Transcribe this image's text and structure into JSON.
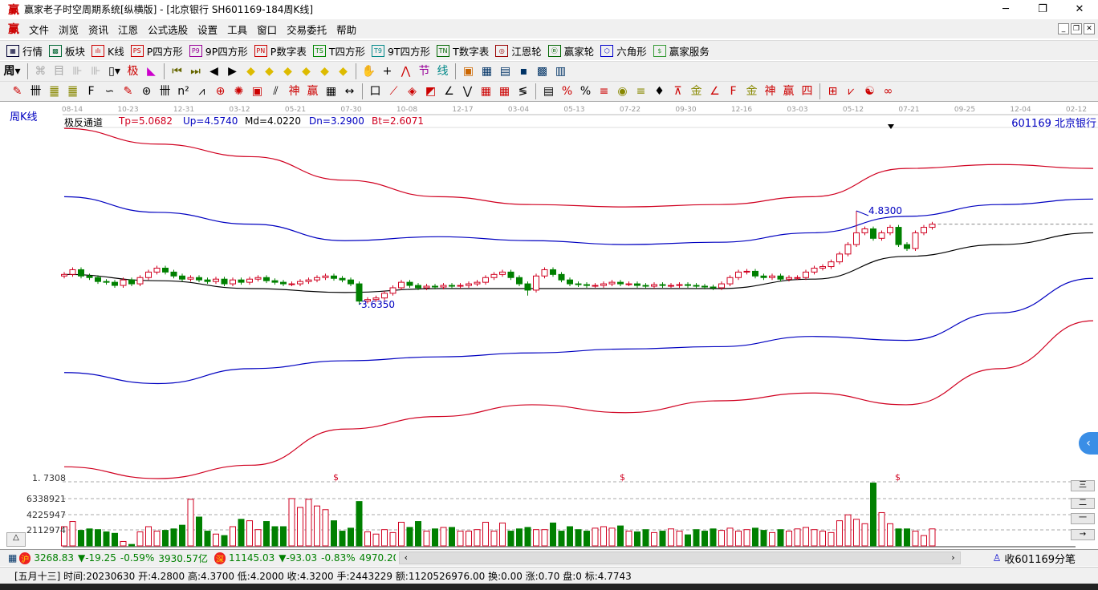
{
  "window": {
    "title": "赢家老子时空周期系统[纵横版] - [北京银行  SH601169-184周K线]",
    "logo": "赢"
  },
  "menu": [
    "文件",
    "浏览",
    "资讯",
    "江恩",
    "公式选股",
    "设置",
    "工具",
    "窗口",
    "交易委托",
    "帮助"
  ],
  "toolbar1": [
    {
      "icon": "grid",
      "glyph": "▦",
      "label": "行情",
      "color": "#003"
    },
    {
      "icon": "blocks",
      "glyph": "▩",
      "label": "板块",
      "color": "#063"
    },
    {
      "icon": "kline",
      "glyph": "ılı",
      "label": "K线",
      "color": "#c00"
    },
    {
      "icon": "PS",
      "glyph": "PS",
      "label": "P四方形",
      "color": "#c00"
    },
    {
      "icon": "P9",
      "glyph": "P9",
      "label": "9P四方形",
      "color": "#909"
    },
    {
      "icon": "PN",
      "glyph": "PN",
      "label": "P数字表",
      "color": "#c00"
    },
    {
      "icon": "TS",
      "glyph": "TS",
      "label": "T四方形",
      "color": "#080"
    },
    {
      "icon": "T9",
      "glyph": "T9",
      "label": "9T四方形",
      "color": "#088"
    },
    {
      "icon": "TN",
      "glyph": "TN",
      "label": "T数字表",
      "color": "#060"
    },
    {
      "icon": "gann-wheel",
      "glyph": "◎",
      "label": "江恩轮",
      "color": "#900"
    },
    {
      "icon": "big-wheel",
      "glyph": "Ⓑ",
      "label": "赢家轮",
      "color": "#060"
    },
    {
      "icon": "hexagon",
      "glyph": "⬡",
      "label": "六角形",
      "color": "#00c"
    },
    {
      "icon": "dollar",
      "glyph": "$",
      "label": "赢家服务",
      "color": "#393"
    }
  ],
  "period_selector": "周",
  "stock_label": "周K线",
  "indicator": {
    "name": "极反通道",
    "tp": "Tp=5.0682",
    "up": "Up=4.5740",
    "md": "Md=4.0220",
    "dn": "Dn=3.2900",
    "bt": "Bt=2.6071"
  },
  "stock_code_name": "601169  北京银行",
  "date_axis": [
    "08-14",
    "10-23",
    "12-31",
    "03-12",
    "05-21",
    "07-30",
    "10-08",
    "12-17",
    "03-04",
    "05-13",
    "07-22",
    "09-30",
    "12-16",
    "03-03",
    "05-12",
    "07-21",
    "09-25",
    "12-04",
    "02-12"
  ],
  "annotations": {
    "high": "4.8300",
    "low": "3.6350",
    "axis_low": "1. 7308",
    "dollar": "$"
  },
  "volume_axis": [
    "6338921",
    "4225947",
    "2112974"
  ],
  "status": {
    "sh": {
      "badge": "沪",
      "value": "3268.83",
      "change": "▼-19.25",
      "pct": "-0.59%",
      "amount": "3930.57亿"
    },
    "sz": {
      "badge": "深",
      "value": "11145.03",
      "change": "▼-93.03",
      "pct": "-0.83%",
      "amount": "4970.20"
    },
    "right": "收601169分笔"
  },
  "info": "[五月十三] 时间:20230630 开:4.2800 高:4.3700 低:4.2000 收:4.3200 手:2443229 额:1120526976.00 换:0.00 涨:0.70 盘:0 标:4.7743",
  "colors": {
    "up": "#d00020",
    "down": "#008000",
    "band_outer": "#d00020",
    "band_inner": "#0000c0",
    "mid": "#000000"
  },
  "chart_data": {
    "type": "candlestick",
    "title": "北京银行 601169 周K线 极反通道",
    "closes": [
      4.02,
      4.08,
      4.0,
      3.98,
      3.93,
      3.92,
      3.88,
      3.95,
      3.9,
      3.98,
      4.05,
      4.1,
      4.05,
      4.0,
      3.96,
      3.98,
      3.95,
      3.93,
      3.96,
      3.9,
      3.95,
      3.92,
      3.96,
      3.98,
      3.94,
      3.92,
      3.9,
      3.9,
      3.93,
      3.95,
      3.98,
      4.0,
      3.97,
      3.95,
      3.9,
      3.68,
      3.7,
      3.72,
      3.78,
      3.85,
      3.92,
      3.88,
      3.85,
      3.87,
      3.86,
      3.88,
      3.87,
      3.88,
      3.9,
      3.92,
      3.98,
      4.02,
      4.05,
      3.98,
      3.9,
      3.82,
      4.0,
      4.08,
      4.02,
      3.95,
      3.9,
      3.89,
      3.88,
      3.88,
      3.9,
      3.92,
      3.9,
      3.9,
      3.88,
      3.87,
      3.89,
      3.88,
      3.88,
      3.89,
      3.88,
      3.87,
      3.86,
      3.85,
      3.9,
      3.98,
      4.05,
      4.06,
      4.0,
      3.98,
      4.0,
      3.96,
      3.98,
      3.98,
      4.05,
      4.1,
      4.12,
      4.18,
      4.28,
      4.4,
      4.55,
      4.6,
      4.48,
      4.55,
      4.62,
      4.4,
      4.35,
      4.55,
      4.62,
      4.66
    ],
    "volumes_millions": [
      2.6,
      3.3,
      2.1,
      2.3,
      2.2,
      1.9,
      1.7,
      0.6,
      0.2,
      1.9,
      2.6,
      2.0,
      2.1,
      2.3,
      2.8,
      6.3,
      3.9,
      2.0,
      1.6,
      1.4,
      2.6,
      3.6,
      3.4,
      2.2,
      3.3,
      2.6,
      2.6,
      6.4,
      5.2,
      6.3,
      5.4,
      4.9,
      3.4,
      2.0,
      2.4,
      6.0,
      1.9,
      1.6,
      2.2,
      1.8,
      3.2,
      2.5,
      3.3,
      2.0,
      2.3,
      2.5,
      2.5,
      2.0,
      2.0,
      2.2,
      3.2,
      2.0,
      3.1,
      2.0,
      2.3,
      2.5,
      2.2,
      2.2,
      3.1,
      2.0,
      2.6,
      2.2,
      2.0,
      2.4,
      2.6,
      2.4,
      2.7,
      2.0,
      1.9,
      2.2,
      1.8,
      2.0,
      2.3,
      2.0,
      1.5,
      2.2,
      2.0,
      2.3,
      2.1,
      2.4,
      2.0,
      2.2,
      2.4,
      2.1,
      1.8,
      2.2,
      2.0,
      2.3,
      2.5,
      2.2,
      2.0,
      1.8,
      3.4,
      4.2,
      3.6,
      3.0,
      8.5,
      4.5,
      3.0,
      2.3,
      2.3,
      2.0,
      1.4,
      2.3
    ],
    "bands": {
      "tp": [
        5.88,
        5.68,
        5.52,
        5.22,
        5.01,
        4.91,
        4.88,
        4.91,
        5.01,
        5.37,
        5.42,
        5.37
      ],
      "up": [
        5.01,
        4.81,
        4.66,
        4.45,
        4.5,
        4.45,
        4.4,
        4.43,
        4.55,
        4.76,
        4.91,
        4.98
      ],
      "md": [
        4.02,
        3.94,
        3.84,
        3.79,
        3.84,
        3.84,
        3.84,
        3.84,
        3.96,
        4.25,
        4.4,
        4.55
      ],
      "dn": [
        2.77,
        2.63,
        2.82,
        2.92,
        2.97,
        3.02,
        3.07,
        3.1,
        3.23,
        3.18,
        3.53,
        3.97
      ],
      "bt": [
        1.57,
        1.42,
        1.59,
        2.05,
        2.21,
        2.36,
        2.26,
        2.41,
        2.51,
        2.36,
        2.82,
        3.43
      ]
    },
    "current_price_line": 4.66
  }
}
